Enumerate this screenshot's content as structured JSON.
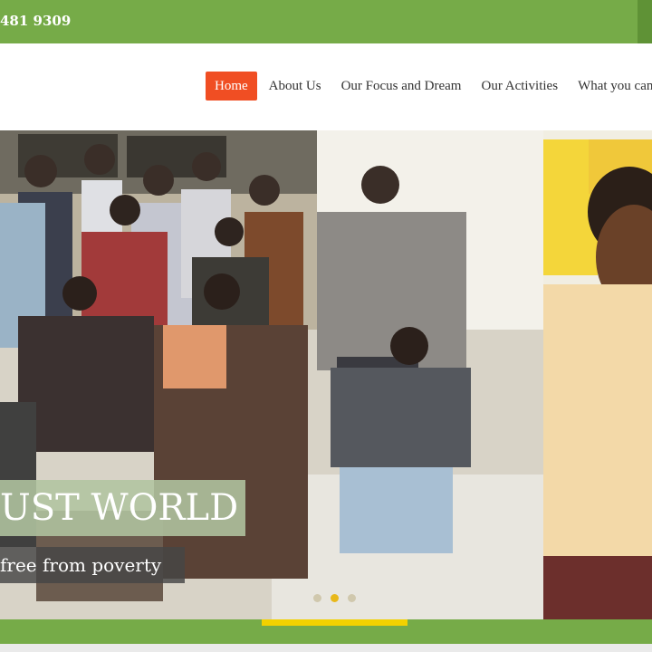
{
  "topbar": {
    "phone": "481 9309"
  },
  "nav": {
    "items": [
      {
        "label": "Home",
        "active": true
      },
      {
        "label": "About Us",
        "active": false
      },
      {
        "label": "Our Focus and Dream",
        "active": false
      },
      {
        "label": "Our Activities",
        "active": false
      },
      {
        "label": "What you can d",
        "active": false
      }
    ]
  },
  "slider": {
    "caption_title": "UST WORLD",
    "caption_subtitle": "free from poverty",
    "dots": 3,
    "active_dot": 2
  },
  "colors": {
    "brand_green": "#76ab48",
    "nav_active": "#f04e23",
    "accent_yellow": "#f2d100"
  }
}
